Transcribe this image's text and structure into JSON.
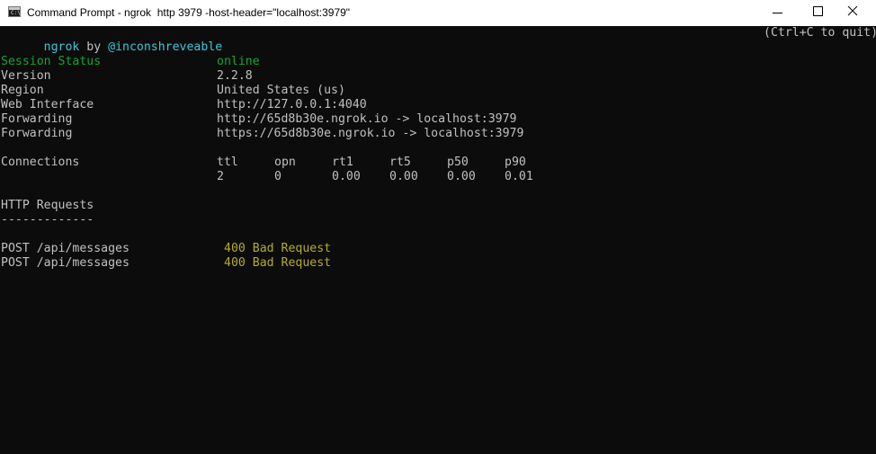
{
  "window": {
    "title": "Command Prompt - ngrok  http 3979 -host-header=\"localhost:3979\""
  },
  "header": {
    "brand": "ngrok",
    "by": "by",
    "author": "@inconshreveable",
    "quit_hint": "(Ctrl+C to quit)"
  },
  "session": {
    "status_label": "Session Status",
    "status_value": "online",
    "version_label": "Version",
    "version_value": "2.2.8",
    "region_label": "Region",
    "region_value": "United States (us)",
    "web_interface_label": "Web Interface",
    "web_interface_value": "http://127.0.0.1:4040",
    "forwarding_label": "Forwarding",
    "forwarding_http": "http://65d8b30e.ngrok.io -> localhost:3979",
    "forwarding_https": "https://65d8b30e.ngrok.io -> localhost:3979"
  },
  "connections": {
    "label": "Connections",
    "headers": [
      "ttl",
      "opn",
      "rt1",
      "rt5",
      "p50",
      "p90"
    ],
    "values": [
      "2",
      "0",
      "0.00",
      "0.00",
      "0.00",
      "0.01"
    ]
  },
  "http_requests": {
    "title": "HTTP Requests",
    "underline": "-------------",
    "rows": [
      {
        "method_path": "POST /api/messages",
        "status": "400 Bad Request"
      },
      {
        "method_path": "POST /api/messages",
        "status": "400 Bad Request"
      }
    ]
  },
  "colors": {
    "online": "#16a23a",
    "cyan": "#3ac7d6",
    "status_yellow": "#b3ac2c",
    "text": "#c0c0c0",
    "background": "#0c0c0c"
  }
}
